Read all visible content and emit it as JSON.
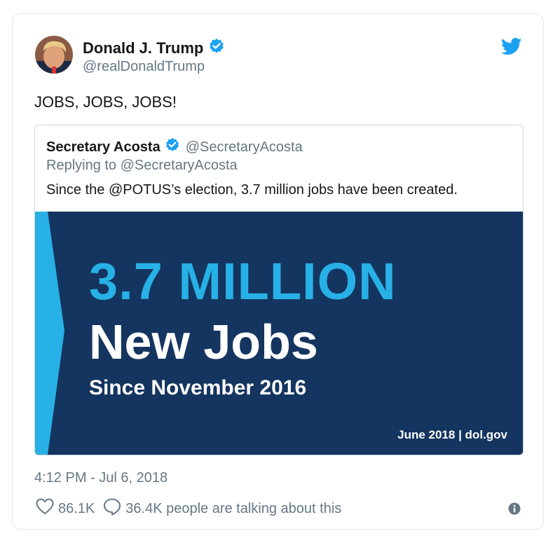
{
  "author": {
    "name": "Donald J. Trump",
    "handle": "@realDonaldTrump",
    "verified": true,
    "avatar_icon": "avatar-photo"
  },
  "tweet": {
    "text": "JOBS, JOBS, JOBS!"
  },
  "quoted_tweet": {
    "name": "Secretary Acosta",
    "handle": "@SecretaryAcosta",
    "verified": true,
    "reply_prefix": "Replying to",
    "reply_handle": "@SecretaryAcosta",
    "text": "Since the @POTUS’s election, 3.7 million jobs have been created.",
    "image": {
      "headline": "3.7 MILLION",
      "subheadline": "New Jobs",
      "since": "Since November 2016",
      "footer": "June 2018 | dol.gov",
      "colors": {
        "background": "#14355f",
        "accent": "#27b1e6",
        "text": "#ffffff"
      }
    }
  },
  "meta": {
    "timestamp": "4:12 PM - Jul 6, 2018"
  },
  "actions": {
    "likes": "86.1K",
    "replies_text": "36.4K people are talking about this"
  },
  "icons": {
    "verified": "verified-badge-icon",
    "brand": "twitter-bird-icon",
    "like": "heart-icon",
    "reply": "speech-bubble-icon",
    "info": "info-icon"
  },
  "colors": {
    "brand_blue": "#1da1f2",
    "secondary_text": "#657786",
    "primary_text": "#14171a",
    "border": "#e1e8ed"
  }
}
